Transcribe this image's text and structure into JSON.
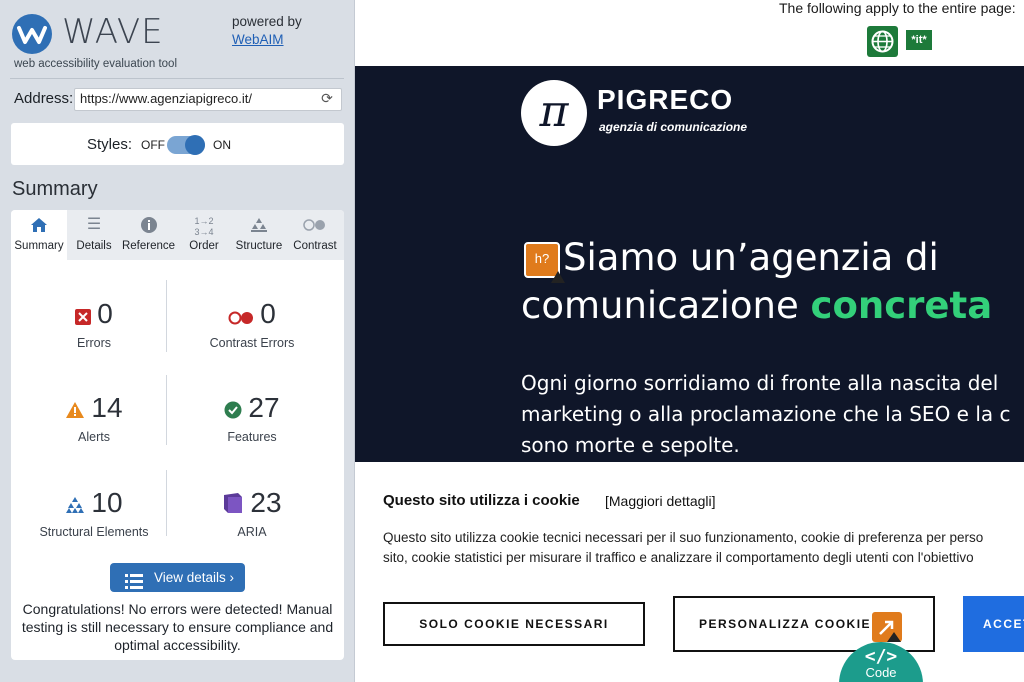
{
  "wave": {
    "logo_word": "WAVE",
    "tagline": "web accessibility evaluation tool",
    "powered_by": "powered by",
    "powered_link": "WebAIM",
    "address_label": "Address:",
    "address_value": "https://www.agenziapigreco.it/",
    "styles_label": "Styles:",
    "styles_off": "OFF",
    "styles_on": "ON",
    "section_title": "Summary",
    "tabs": [
      {
        "label": "Summary",
        "icon": "home-icon",
        "active": true
      },
      {
        "label": "Details",
        "icon": "list-icon"
      },
      {
        "label": "Reference",
        "icon": "info-icon"
      },
      {
        "label": "Order",
        "icon": "order-icon"
      },
      {
        "label": "Structure",
        "icon": "structure-icon"
      },
      {
        "label": "Contrast",
        "icon": "contrast-icon"
      }
    ],
    "stats": {
      "errors": {
        "value": "0",
        "label": "Errors"
      },
      "contrast_errors": {
        "value": "0",
        "label": "Contrast Errors"
      },
      "alerts": {
        "value": "14",
        "label": "Alerts"
      },
      "features": {
        "value": "27",
        "label": "Features"
      },
      "structural": {
        "value": "10",
        "label": "Structural Elements"
      },
      "aria": {
        "value": "23",
        "label": "ARIA"
      }
    },
    "view_details": "View details ›",
    "congrats": "Congratulations! No errors were detected! Manual testing is still necessary to ensure compliance and optimal accessibility."
  },
  "site": {
    "notice": "The following apply to the entire page:",
    "lang_badge": "*it*",
    "brand_symbol": "π",
    "brand_name": "PIGRECO",
    "brand_tag": "agenzia di comunicazione",
    "heading_icon": "h?",
    "heading_line1": "Siamo un’agenzia di",
    "heading_line2_plain": "comunicazione ",
    "heading_line2_accent": "concreta",
    "para_line1": "Ogni giorno sorridiamo di fronte alla nascita del",
    "para_line2": "marketing o alla proclamazione che la SEO e la c",
    "para_line3": "sono morte e sepolte.",
    "cookie": {
      "title": "Questo sito utilizza i cookie",
      "details_link": "[Maggiori dettagli]",
      "text_line1": "Questo sito utilizza cookie tecnici necessari per il suo funzionamento, cookie di preferenza per perso",
      "text_line2": "sito, cookie statistici per misurare il traffico e analizzare il comportamento degli utenti con l'obiettivo",
      "btn_necessary": "SOLO COOKIE NECESSARI",
      "btn_customize": "PERSONALIZZA COOKIE",
      "btn_accept": "ACCET"
    },
    "code_tab_icon": "</>",
    "code_tab_label": "Code"
  },
  "colors": {
    "wave_blue": "#2f6fb5",
    "hero_bg": "#0f1629",
    "accent_green": "#33d07a",
    "error_red": "#c62828",
    "alert_orange": "#e8891d",
    "feature_green": "#2e7d4f",
    "aria_purple": "#5b3a99",
    "code_teal": "#1c9c8c"
  }
}
